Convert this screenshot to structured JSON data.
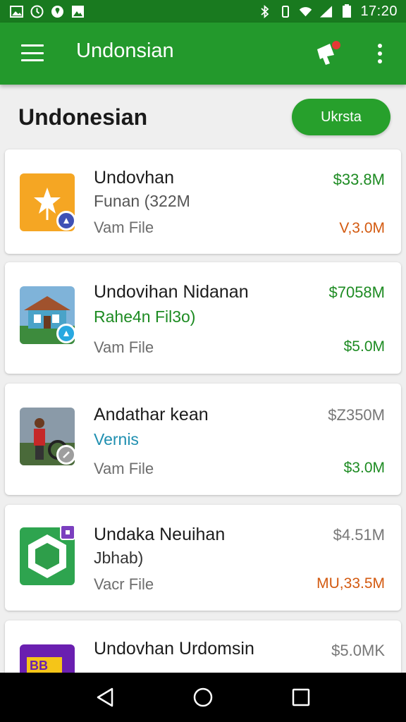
{
  "status_bar": {
    "time": "17:20",
    "left_icons": [
      "gallery-icon",
      "clock-icon",
      "location-icon",
      "image-icon"
    ],
    "right_icons": [
      "bluetooth-icon",
      "vibrate-icon",
      "wifi-icon",
      "signal-icon",
      "battery-icon"
    ]
  },
  "app_bar": {
    "title": "Undonsian",
    "actions": [
      "notification-icon",
      "more-options-icon"
    ]
  },
  "section": {
    "title": "Undonesian",
    "action_label": "Ukrsta"
  },
  "colors": {
    "app_bar": "#23992c",
    "status_bar": "#197a1f",
    "accent_green": "#1d8b22",
    "accent_orange": "#d35a10",
    "accent_blue": "#1f8fb0"
  },
  "items": [
    {
      "name": "Undovhan",
      "sub": "Funan (322M",
      "type": "Vam File",
      "price": "$33.8M",
      "size": "V,3.0M",
      "size_color": "#d35a10",
      "sub_color": "#555555"
    },
    {
      "name": "Undovihan Nidanan",
      "sub": "Rahe4n Fil3o)",
      "type": "Vam File",
      "price": "$7058M",
      "size": "$5.0M",
      "size_color": "#1d8b22",
      "sub_color": "#1d8b22"
    },
    {
      "name": "Andathar kean",
      "sub": "Vernis",
      "type": "Vam File",
      "price": "$Z350M",
      "size": "$3.0M",
      "size_color": "#1d8b22",
      "sub_color": "#1f8fb0"
    },
    {
      "name": "Undaka Neuihan",
      "sub": "Jbhab)",
      "type": "Vacr File",
      "price": "$4.51M",
      "size": "MU,33.5M",
      "size_color": "#d35a10",
      "sub_color": "#333333"
    },
    {
      "name": "Undovhan Urdomsin",
      "sub": "",
      "type": "",
      "price": "$5.0MK",
      "size": "",
      "size_color": "#1d8b22",
      "sub_color": "#555555"
    }
  ],
  "nav_bar": [
    "back-icon",
    "home-icon",
    "recents-icon"
  ]
}
